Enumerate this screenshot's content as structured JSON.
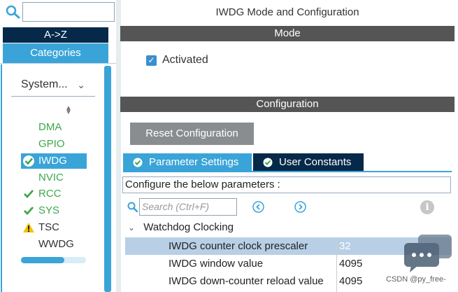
{
  "left": {
    "az_label": "A->Z",
    "categories_label": "Categories",
    "system_select": "System...",
    "items": [
      {
        "label": "DMA",
        "status": "none"
      },
      {
        "label": "GPIO",
        "status": "none"
      },
      {
        "label": "IWDG",
        "status": "check-selected"
      },
      {
        "label": "NVIC",
        "status": "none"
      },
      {
        "label": "RCC",
        "status": "check"
      },
      {
        "label": "SYS",
        "status": "check"
      },
      {
        "label": "TSC",
        "status": "warning"
      },
      {
        "label": "WWDG",
        "status": "none"
      }
    ]
  },
  "main": {
    "title": "IWDG Mode and Configuration",
    "mode_header": "Mode",
    "activated_label": "Activated",
    "activated_checked": true,
    "configuration_header": "Configuration",
    "reset_button": "Reset Configuration",
    "tabs": [
      {
        "label": "Parameter Settings",
        "active": true
      },
      {
        "label": "User Constants",
        "active": false
      }
    ],
    "hint": "Configure the below parameters :",
    "search_placeholder": "Search (Ctrl+F)",
    "group_label": "Watchdog Clocking",
    "params": [
      {
        "name": "IWDG counter clock prescaler",
        "value": "32",
        "selected": true
      },
      {
        "name": "IWDG window value",
        "value": "4095",
        "selected": false
      },
      {
        "name": "IWDG down-counter reload value",
        "value": "4095",
        "selected": false
      }
    ],
    "watermark": "CSDN @py_free-"
  },
  "colors": {
    "accent": "#3aa4d8",
    "navy": "#06294a",
    "bar": "#555555",
    "green": "#3ba84a",
    "warning": "#f2c200"
  }
}
